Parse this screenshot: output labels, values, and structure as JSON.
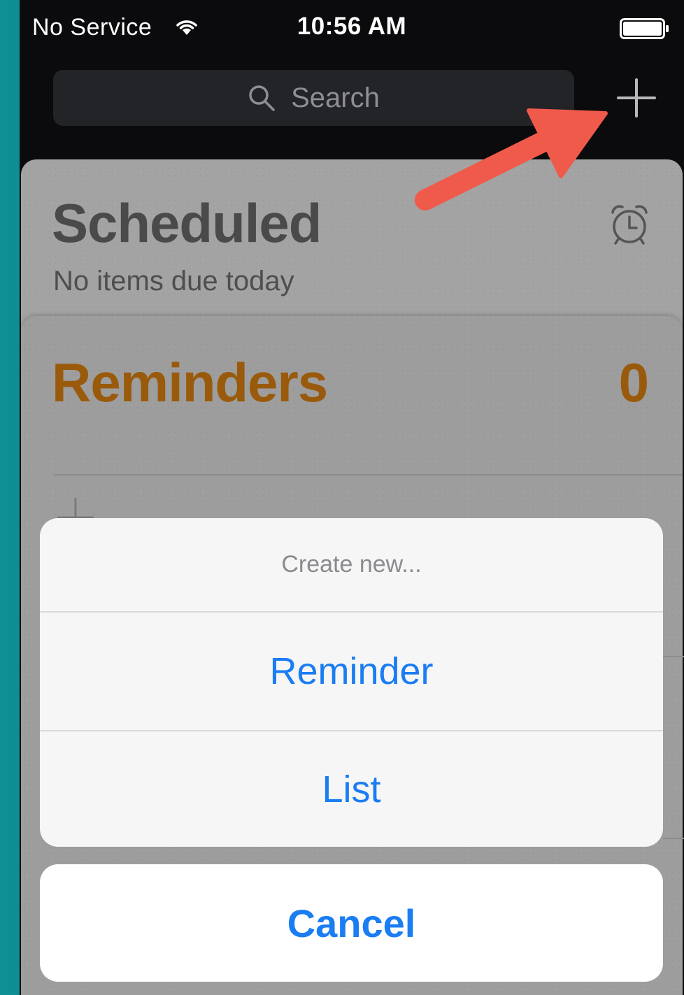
{
  "status_bar": {
    "carrier": "No Service",
    "time": "10:56 AM",
    "wifi_icon": "wifi-icon",
    "battery_icon": "battery-icon"
  },
  "search": {
    "placeholder": "Search",
    "icon": "search-icon"
  },
  "nav": {
    "add_icon": "plus-icon"
  },
  "scheduled": {
    "title": "Scheduled",
    "subtitle": "No items due today",
    "icon": "alarm-clock-icon"
  },
  "reminders": {
    "title": "Reminders",
    "count": "0",
    "add_item_icon": "plus-icon"
  },
  "action_sheet": {
    "title": "Create new...",
    "options": [
      {
        "label": "Reminder"
      },
      {
        "label": "List"
      }
    ],
    "cancel_label": "Cancel"
  },
  "colors": {
    "accent_blue": "#1a7df2",
    "reminders_orange": "#9a5a0c",
    "annotation_arrow": "#f05a4b"
  }
}
